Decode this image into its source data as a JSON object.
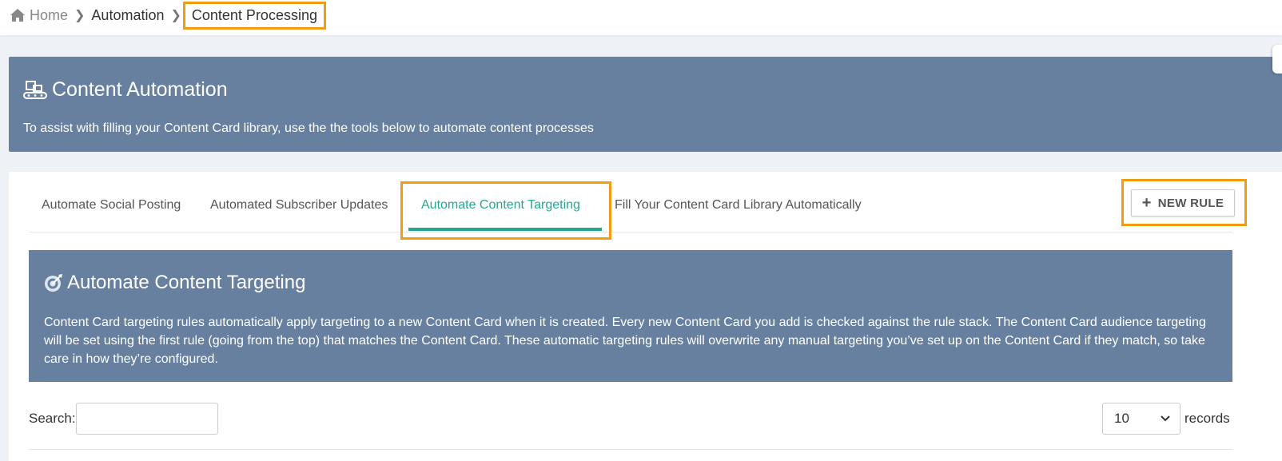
{
  "breadcrumb": {
    "home": "Home",
    "level1": "Automation",
    "current": "Content Processing"
  },
  "hero": {
    "title": "Content Automation",
    "description": "To assist with filling your Content Card library, use the the tools below to automate content processes"
  },
  "tabs": [
    {
      "label": "Automate Social Posting",
      "active": false
    },
    {
      "label": "Automated Subscriber Updates",
      "active": false
    },
    {
      "label": "Automate Content Targeting",
      "active": true
    },
    {
      "label": "Fill Your Content Card Library Automatically",
      "active": false
    }
  ],
  "toolbar": {
    "new_rule_label": "NEW RULE"
  },
  "info": {
    "title": "Automate Content Targeting",
    "body": "Content Card targeting rules automatically apply targeting to a new Content Card when it is created. Every new Content Card you add is checked against the rule stack. The Content Card audience targeting will be set using the first rule (going from the top) that matches the Content Card. These automatic targeting rules will overwrite any manual targeting you’ve set up on the Content Card if they match, so take care in how they’re configured."
  },
  "table_controls": {
    "search_label": "Search:",
    "search_value": "",
    "records_value": "10",
    "records_label": "records"
  },
  "colors": {
    "panel": "#6780a0",
    "accent": "#2aa58f",
    "highlight": "#f39c12"
  },
  "icons": {
    "home": "home-icon",
    "separator": "chevron-right-icon",
    "hero": "conveyor-icon",
    "info": "target-icon",
    "plus": "plus-icon",
    "select": "chevron-down-icon"
  }
}
